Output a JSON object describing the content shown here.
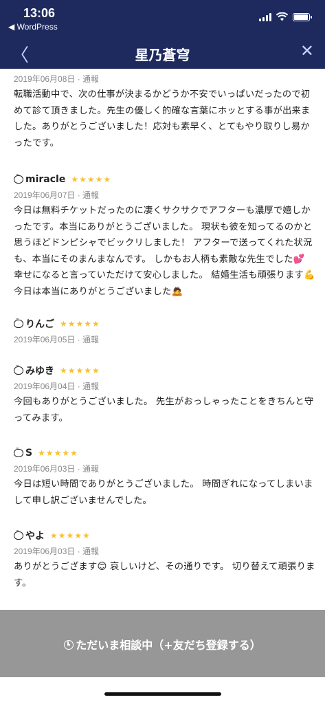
{
  "status": {
    "time": "13:06",
    "back_app": "◀ WordPress",
    "battery_level": 0.95
  },
  "header": {
    "back_glyph": "〈",
    "title": "星乃蒼穹",
    "close_glyph": "✕"
  },
  "reviews": [
    {
      "name": "",
      "stars": "",
      "meta": "2019年06月08日 · 通報",
      "text": "転職活動中で、次の仕事が決まるかどうか不安でいっぱいだったので初めて診て頂きました。先生の優しく的確な言葉にホッとする事が出来ました。ありがとうございました！応対も素早く、とてもやり取りし易かったです。"
    },
    {
      "name": "miracle",
      "stars": "★★★★★",
      "meta": "2019年06月07日 · 通報",
      "text": "今日は無料チケットだったのに凄くサクサクでアフターも濃厚で嬉しかったです。本当にありがとうございました。 現状も彼を知ってるのかと思うほどドンピシャでビックリしました！ アフターで送ってくれた状況も、本当にそのまんまなんです。 しかもお人柄も素敵な先生でした💕 幸せになると言っていただけて安心しました。 結婚生活も頑張ります💪 今日は本当にありがとうございました🙇"
    },
    {
      "name": "りんご",
      "stars": "★★★★★",
      "meta": "2019年06月05日 · 通報",
      "text": ""
    },
    {
      "name": "みゆき",
      "stars": "★★★★★",
      "meta": "2019年06月04日 · 通報",
      "text": "今回もありがとうございました。 先生がおっしゃったことをきちんと守ってみます。"
    },
    {
      "name": "S",
      "stars": "★★★★★",
      "meta": "2019年06月03日 · 通報",
      "text": "今日は短い時間でありがとうございました。 時間ぎれになってしまいまして申し訳ございませんでした。"
    },
    {
      "name": "やよ",
      "stars": "★★★★★",
      "meta": "2019年06月03日 · 通報",
      "text": "ありがとうござます😊 哀しいけど、その通りです。 切り替えて頑張ります。"
    }
  ],
  "bottom": {
    "label": "ただいま相談中（+友だち登録する）"
  }
}
